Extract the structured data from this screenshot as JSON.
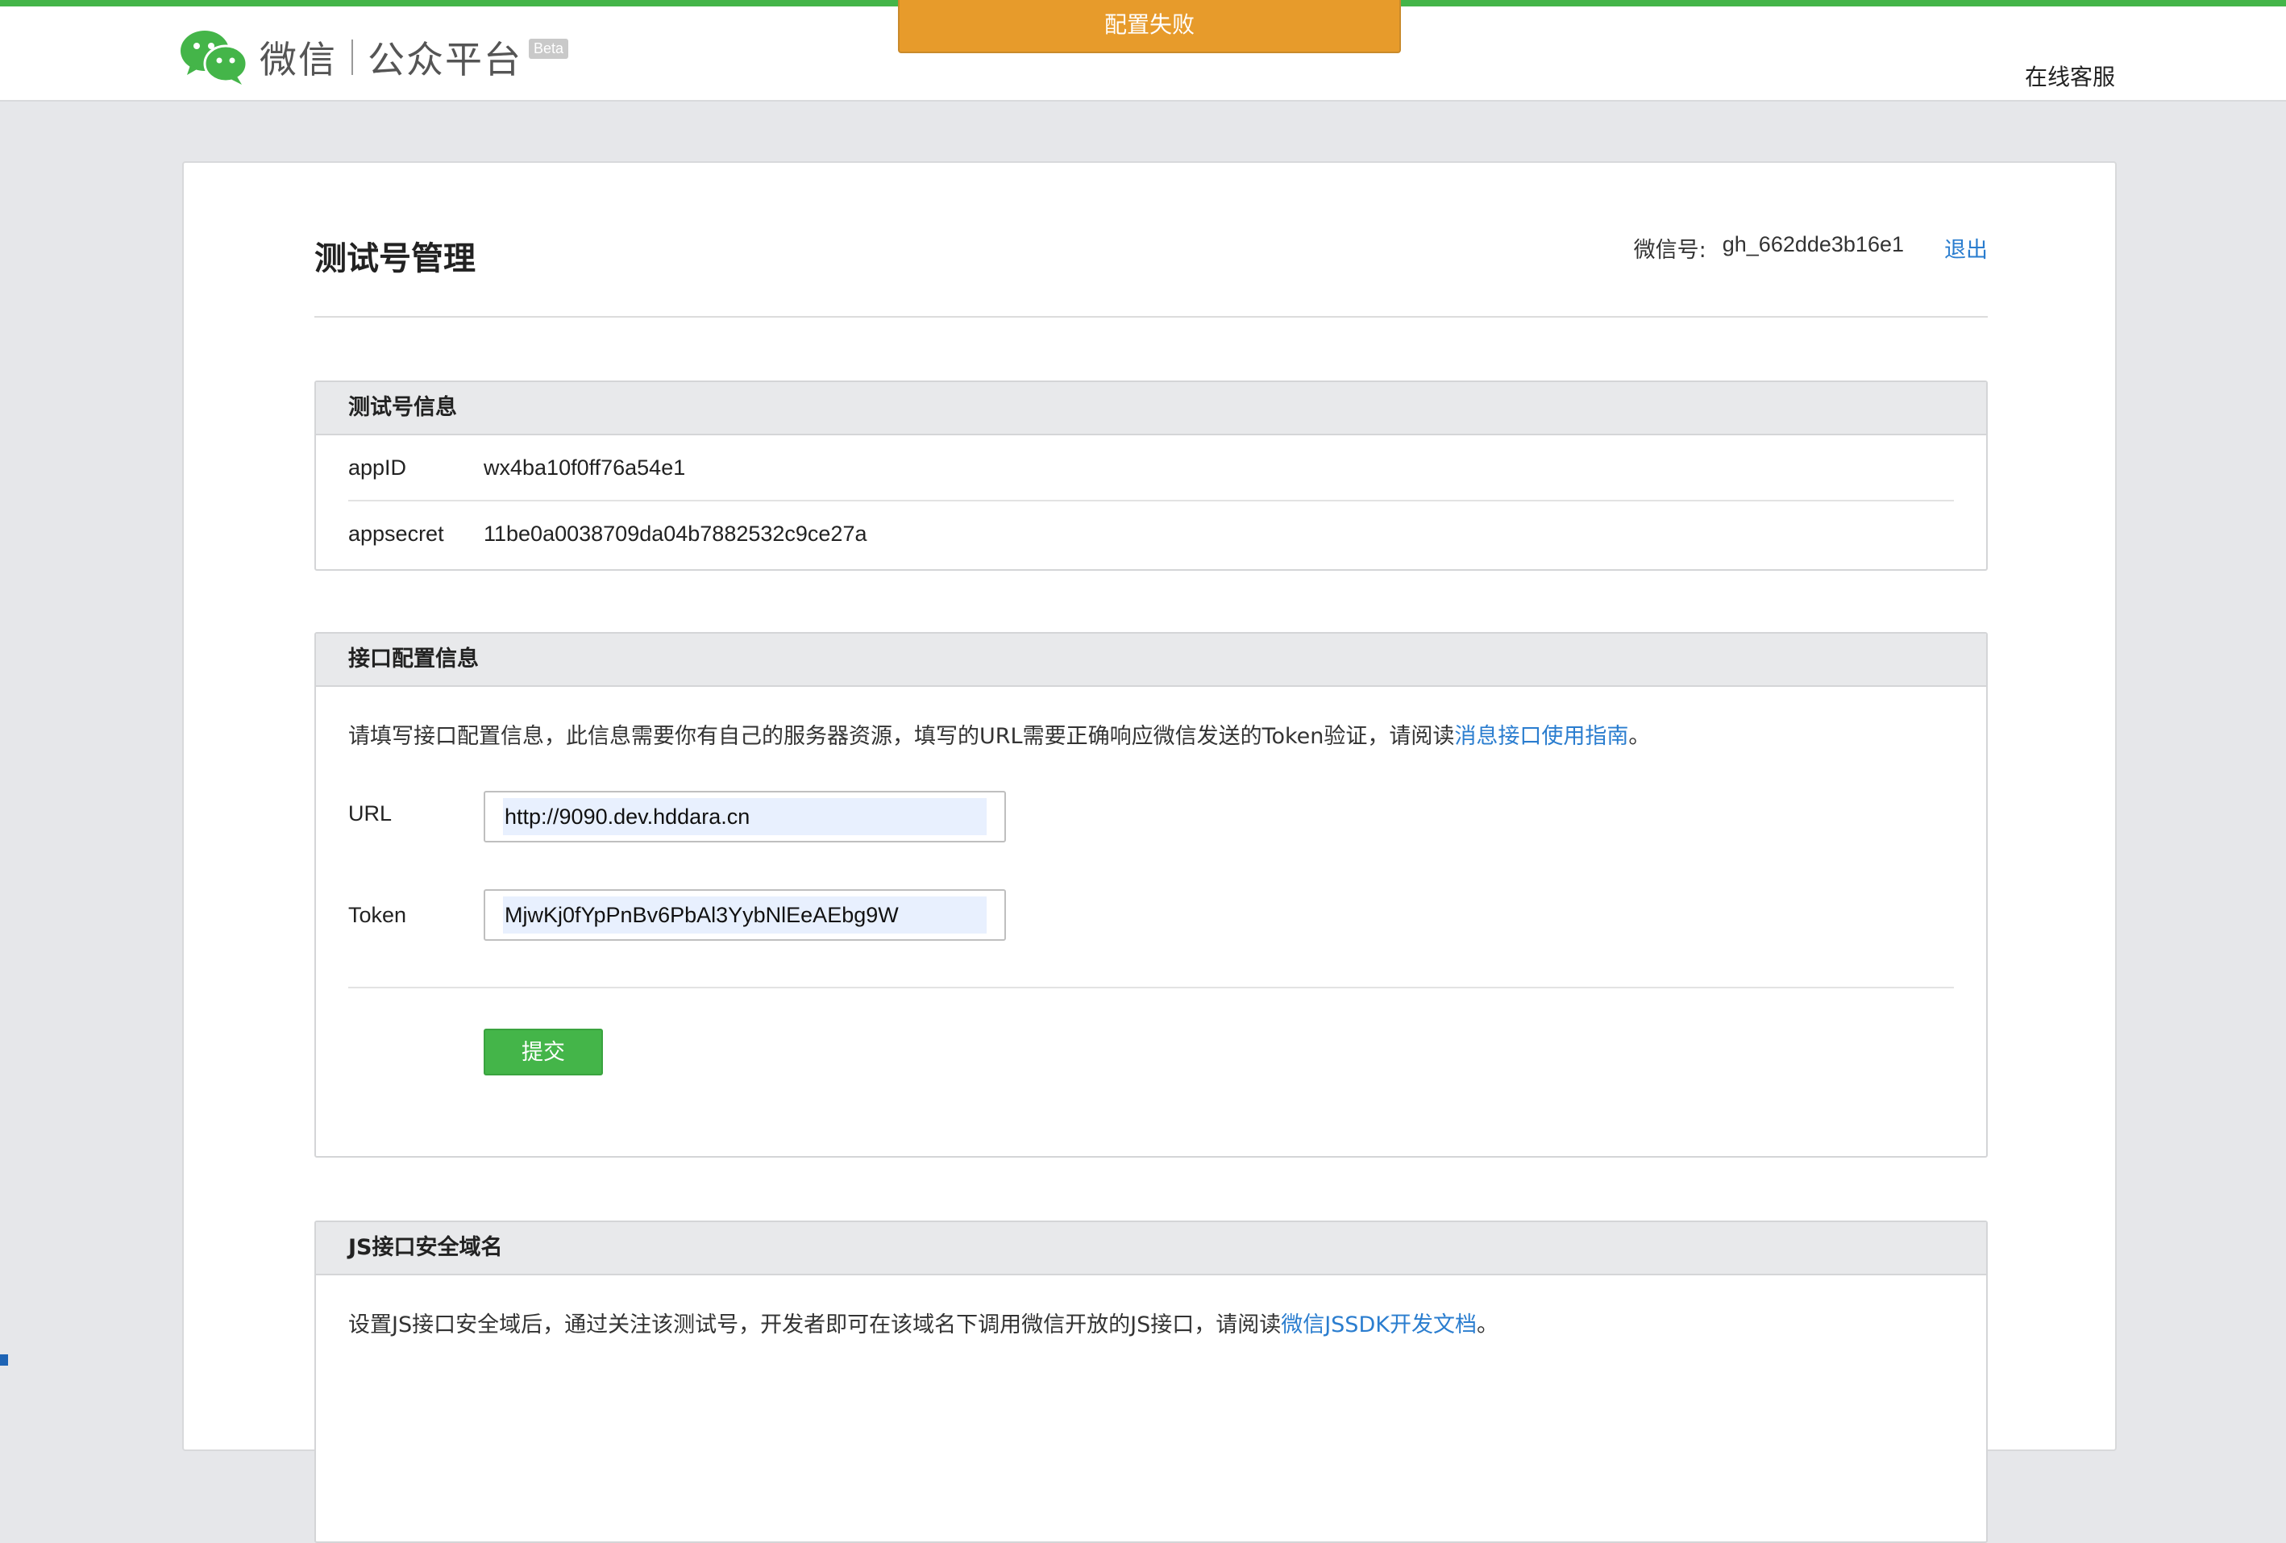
{
  "header": {
    "logo_brand": "微信",
    "logo_product": "公众平台",
    "logo_badge": "Beta",
    "service_link": "在线客服"
  },
  "alert": {
    "message": "配置失败"
  },
  "page": {
    "title": "测试号管理",
    "account_label": "微信号:",
    "account_id": "gh_662dde3b16e1",
    "logout": "退出"
  },
  "test_info": {
    "title": "测试号信息",
    "rows": [
      {
        "key": "appID",
        "value": "wx4ba10f0ff76a54e1"
      },
      {
        "key": "appsecret",
        "value": "11be0a0038709da04b7882532c9ce27a"
      }
    ]
  },
  "api_config": {
    "title": "接口配置信息",
    "desc_prefix": "请填写接口配置信息，此信息需要你有自己的服务器资源，填写的URL需要正确响应微信发送的Token验证，请阅读",
    "desc_link": "消息接口使用指南",
    "desc_suffix": "。",
    "url_label": "URL",
    "url_value": "http://9090.dev.hddara.cn",
    "token_label": "Token",
    "token_value": "MjwKj0fYpPnBv6PbAl3YybNlEeAEbg9W",
    "submit": "提交"
  },
  "js_domain": {
    "title": "JS接口安全域名",
    "desc_prefix": "设置JS接口安全域后，通过关注该测试号，开发者即可在该域名下调用微信开放的JS接口，请阅读",
    "desc_link": "微信JSSDK开发文档",
    "desc_suffix": "。"
  },
  "colors": {
    "brand_green": "#44b549",
    "alert_orange": "#e79b2b",
    "link_blue": "#2a7dcf"
  }
}
